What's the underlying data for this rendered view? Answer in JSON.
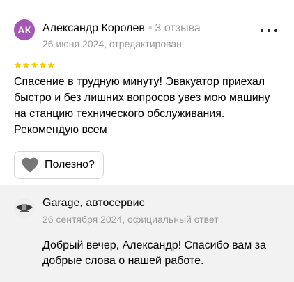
{
  "review": {
    "avatar_initials": "АК",
    "avatar_color": "#a356b3",
    "author_name": "Александр Королев",
    "separator": "•",
    "review_count": "3 отзыва",
    "meta": "26 июня 2024, отредактирован",
    "rating": 5,
    "rating_max": 5,
    "star_color": "#ffcc00",
    "text": "Спасение в трудную минуту! Эвакуатор приехал быстро и без лишних вопросов увез мою машину на станцию технического обслуживания. Рекомендую всем",
    "more_icon": "more-dots-icon",
    "helpful_icon": "heart-icon",
    "helpful_label": "Полезно?"
  },
  "reply": {
    "logo_icon": "garage-logo-icon",
    "author_name": "Garage, автосервис",
    "meta": "26 сентября 2024, официальный ответ",
    "text": "Добрый вечер, Александр! Спасибо вам за добрые слова о нашей работе."
  }
}
